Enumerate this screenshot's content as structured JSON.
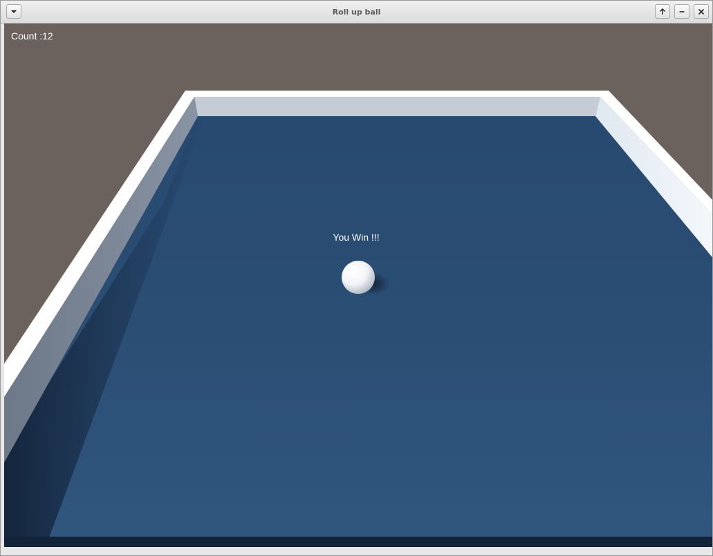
{
  "window": {
    "title": "Roll up ball"
  },
  "titlebar": {
    "menu_icon": "chevron-down-icon",
    "maximize_icon": "arrow-up-icon",
    "minimize_icon": "minus-icon",
    "close_icon": "close-icon"
  },
  "hud": {
    "count_text": "Count :12",
    "win_text": "You Win !!!"
  },
  "colors": {
    "background": "#6c625d",
    "ground": "#2c4e75",
    "wall_top": "#ffffff",
    "wall_side": "#7f8a98",
    "ball": "#ffffff"
  }
}
